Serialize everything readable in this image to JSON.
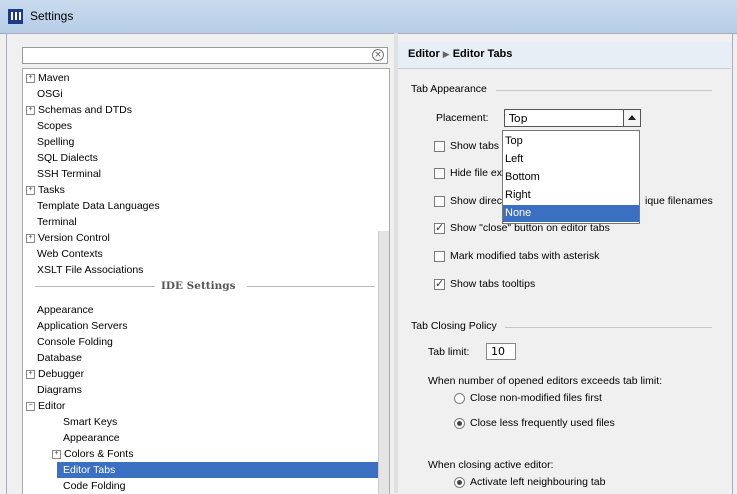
{
  "window": {
    "title": "Settings"
  },
  "search": {
    "value": ""
  },
  "tree": {
    "items": [
      {
        "label": "Maven",
        "exp": "+"
      },
      {
        "label": "OSGi"
      },
      {
        "label": "Schemas and DTDs",
        "exp": "+"
      },
      {
        "label": "Scopes"
      },
      {
        "label": "Spelling"
      },
      {
        "label": "SQL Dialects"
      },
      {
        "label": "SSH Terminal"
      },
      {
        "label": "Tasks",
        "exp": "+"
      },
      {
        "label": "Template Data Languages"
      },
      {
        "label": "Terminal"
      },
      {
        "label": "Version Control",
        "exp": "+"
      },
      {
        "label": "Web Contexts"
      },
      {
        "label": "XSLT File Associations"
      }
    ],
    "section_label": "IDE Settings",
    "ide_items": [
      {
        "label": "Appearance"
      },
      {
        "label": "Application Servers"
      },
      {
        "label": "Console Folding"
      },
      {
        "label": "Database"
      },
      {
        "label": "Debugger",
        "exp": "+"
      },
      {
        "label": "Diagrams"
      },
      {
        "label": "Editor",
        "exp": "−"
      },
      {
        "label": "Smart Keys",
        "child": true
      },
      {
        "label": "Appearance",
        "child": true
      },
      {
        "label": "Colors & Fonts",
        "child": true,
        "exp": "+"
      },
      {
        "label": "Editor Tabs",
        "child": true,
        "selected": true
      },
      {
        "label": "Code Folding",
        "child": true
      }
    ]
  },
  "header": {
    "crumb_parent": "Editor",
    "crumb_current": "Editor Tabs"
  },
  "tab_appearance": {
    "group_label": "Tab Appearance",
    "placement_label": "Placement:",
    "placement_value": "Top",
    "placement_options": [
      "Top",
      "Left",
      "Bottom",
      "Right",
      "None"
    ],
    "placement_highlighted": "None",
    "show_tabs_in_single_row": {
      "label_visible": "Show tabs",
      "checked": false
    },
    "hide_file_extension": {
      "label_visible": "Hide file ex",
      "checked": false
    },
    "show_directory": {
      "label_visible_left": "Show direc",
      "label_visible_right": "ique filenames",
      "checked": false
    },
    "show_close_button": {
      "label_visible": "button on editor tabs",
      "checked": true
    },
    "mark_modified": {
      "label": "Mark modified tabs with asterisk",
      "checked": false
    },
    "show_tooltips": {
      "label": "Show tabs tooltips",
      "checked": true
    }
  },
  "tab_closing": {
    "group_label": "Tab Closing Policy",
    "tab_limit_label": "Tab limit:",
    "tab_limit_value": "10",
    "exceeds_label": "When number of opened editors exceeds tab limit:",
    "close_non_modified": {
      "label": "Close non-modified files first",
      "selected": false
    },
    "close_less_frequent": {
      "label": "Close less frequently used files",
      "selected": true
    },
    "closing_active_label": "When closing active editor:",
    "activate_left": {
      "label": "Activate left neighbouring tab",
      "selected": true
    }
  },
  "colors": {
    "selection": "#3a6fc1",
    "titlebar": "#c9dbee",
    "panel_bg": "#f0f0f0"
  }
}
